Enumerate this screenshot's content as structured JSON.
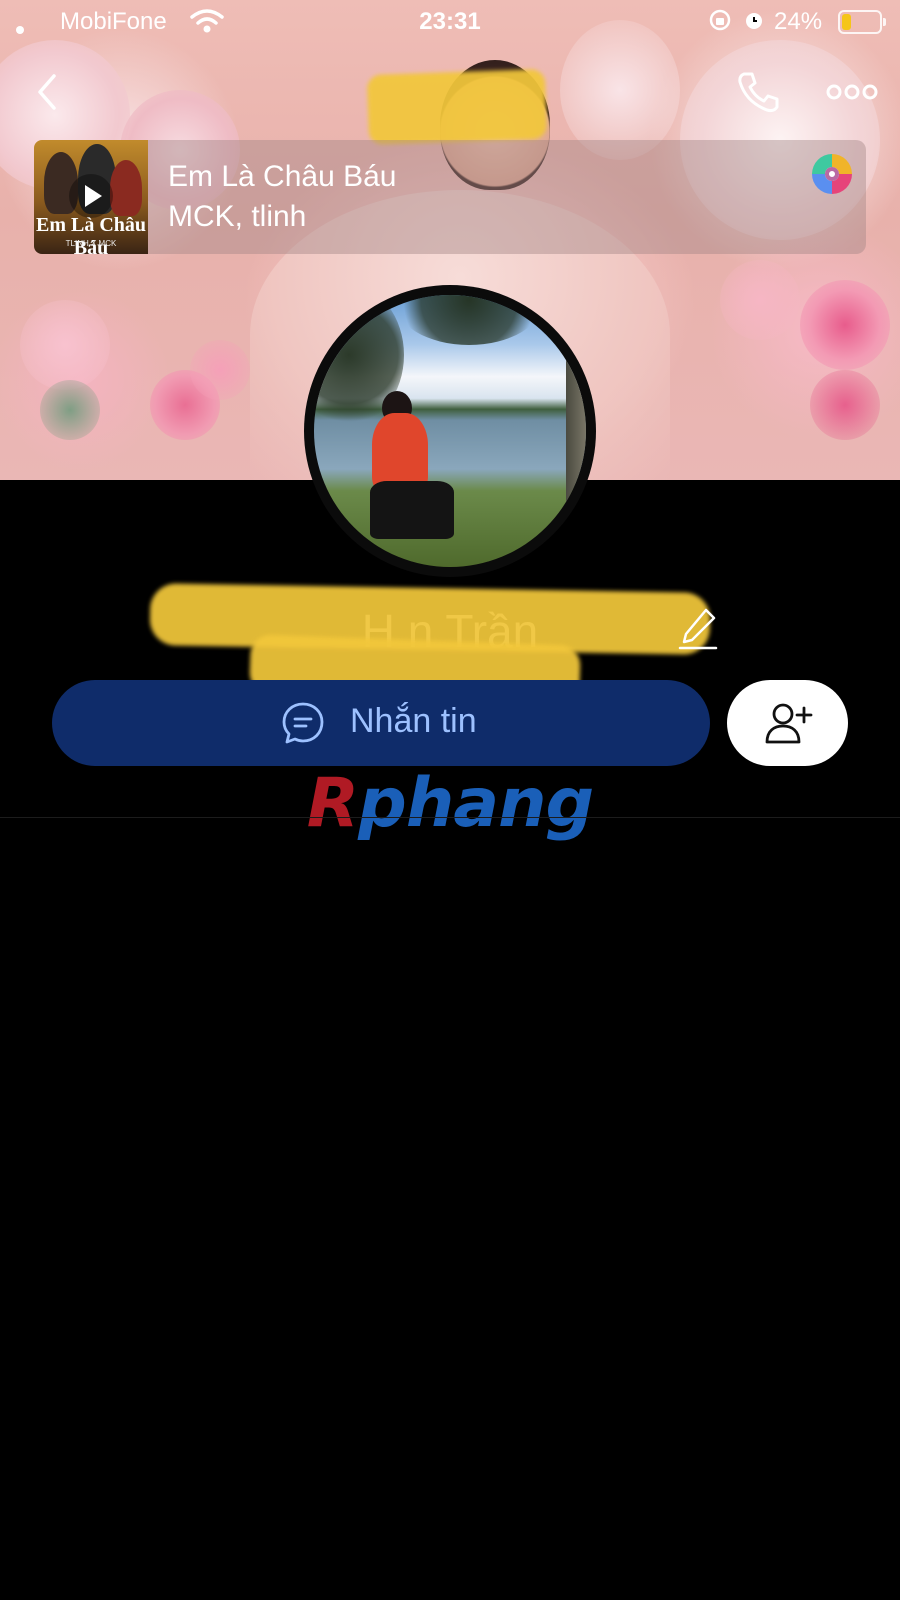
{
  "status_bar": {
    "carrier": "MobiFone",
    "time": "23:31",
    "battery_percent": "24%",
    "battery_level": 0.24
  },
  "nav": {
    "back_icon": "chevron-left-icon",
    "call_icon": "phone-icon",
    "more_icon": "more-horizontal-icon"
  },
  "music": {
    "song_title": "Em Là Châu Báu",
    "artist": "MCK, tlinh",
    "album_art_title": "Em Là Châu Báu",
    "album_art_sub": "TLINH X MCK"
  },
  "profile": {
    "display_name": "H        n Trần"
  },
  "actions": {
    "message_label": "Nhắn tin",
    "message_icon": "chat-bubble-icon",
    "add_friend_icon": "add-user-icon"
  },
  "watermark": {
    "first_letter": "R",
    "rest": "phang"
  },
  "colors": {
    "message_button_bg": "#0f2c6a",
    "message_button_text": "#9dc1ff",
    "background": "#000000",
    "redaction": "#f2c73b"
  }
}
